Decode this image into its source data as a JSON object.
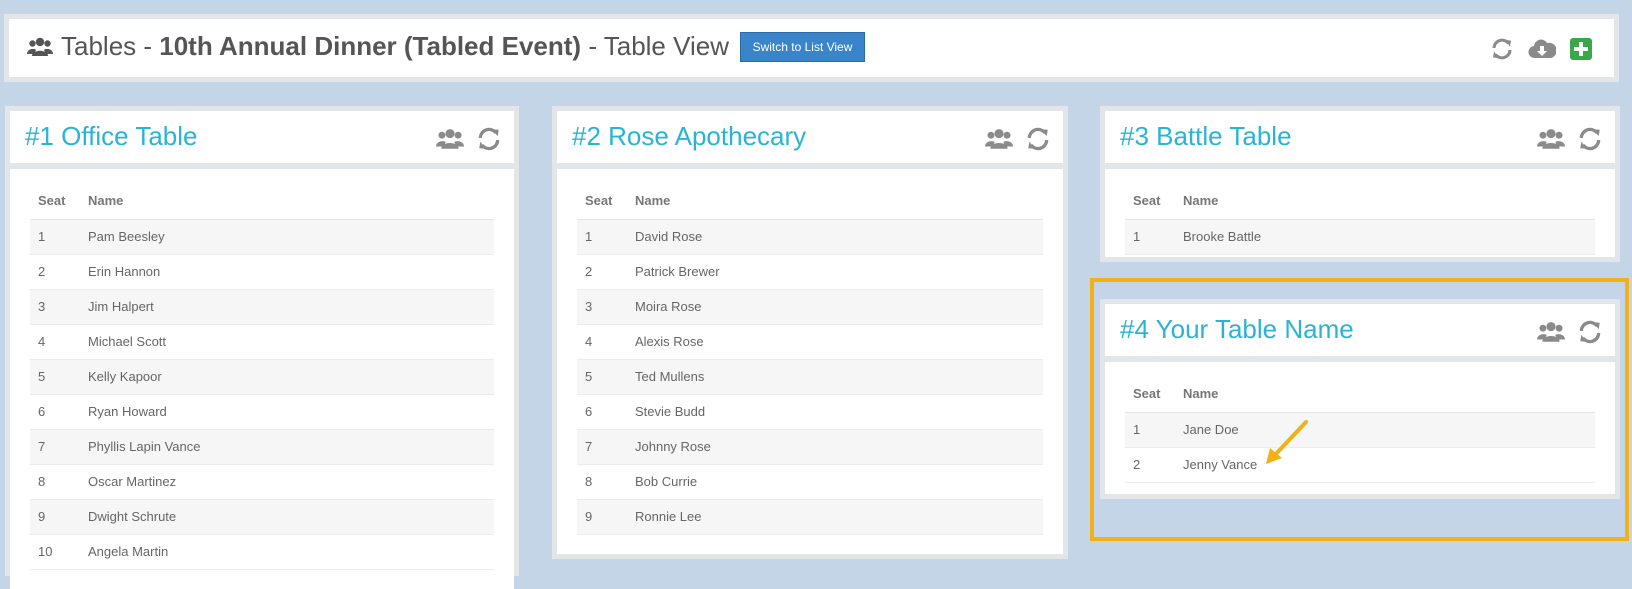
{
  "header": {
    "title_prefix": "Tables - ",
    "event_name": "10th Annual Dinner (Tabled Event)",
    "title_suffix": " - Table View",
    "switch_button": "Switch to List View",
    "icons": [
      "users-icon",
      "refresh-icon",
      "cloud-download-icon",
      "add-icon"
    ]
  },
  "columns": {
    "seat": "Seat",
    "name": "Name"
  },
  "tables": [
    {
      "title": "#1 Office Table",
      "guests": [
        {
          "seat": "1",
          "name": "Pam Beesley"
        },
        {
          "seat": "2",
          "name": "Erin Hannon"
        },
        {
          "seat": "3",
          "name": "Jim Halpert"
        },
        {
          "seat": "4",
          "name": "Michael Scott"
        },
        {
          "seat": "5",
          "name": "Kelly Kapoor"
        },
        {
          "seat": "6",
          "name": "Ryan Howard"
        },
        {
          "seat": "7",
          "name": "Phyllis Lapin Vance"
        },
        {
          "seat": "8",
          "name": "Oscar Martinez"
        },
        {
          "seat": "9",
          "name": "Dwight Schrute"
        },
        {
          "seat": "10",
          "name": "Angela Martin"
        }
      ]
    },
    {
      "title": "#2 Rose Apothecary",
      "guests": [
        {
          "seat": "1",
          "name": "David Rose"
        },
        {
          "seat": "2",
          "name": "Patrick Brewer"
        },
        {
          "seat": "3",
          "name": "Moira Rose"
        },
        {
          "seat": "4",
          "name": "Alexis Rose"
        },
        {
          "seat": "5",
          "name": "Ted Mullens"
        },
        {
          "seat": "6",
          "name": "Stevie Budd"
        },
        {
          "seat": "7",
          "name": "Johnny Rose"
        },
        {
          "seat": "8",
          "name": "Bob Currie"
        },
        {
          "seat": "9",
          "name": "Ronnie Lee"
        }
      ]
    },
    {
      "title": "#3 Battle Table",
      "guests": [
        {
          "seat": "1",
          "name": "Brooke Battle"
        }
      ]
    },
    {
      "title": "#4 Your Table Name",
      "guests": [
        {
          "seat": "1",
          "name": "Jane Doe"
        },
        {
          "seat": "2",
          "name": "Jenny Vance"
        }
      ]
    }
  ],
  "colors": {
    "background": "#c3d5e6",
    "accent_title": "#2bb3d6",
    "button_blue": "#3a84c9",
    "add_green": "#3aa84a",
    "highlight": "#f2b217",
    "icon_gray": "#8a8a8a"
  }
}
